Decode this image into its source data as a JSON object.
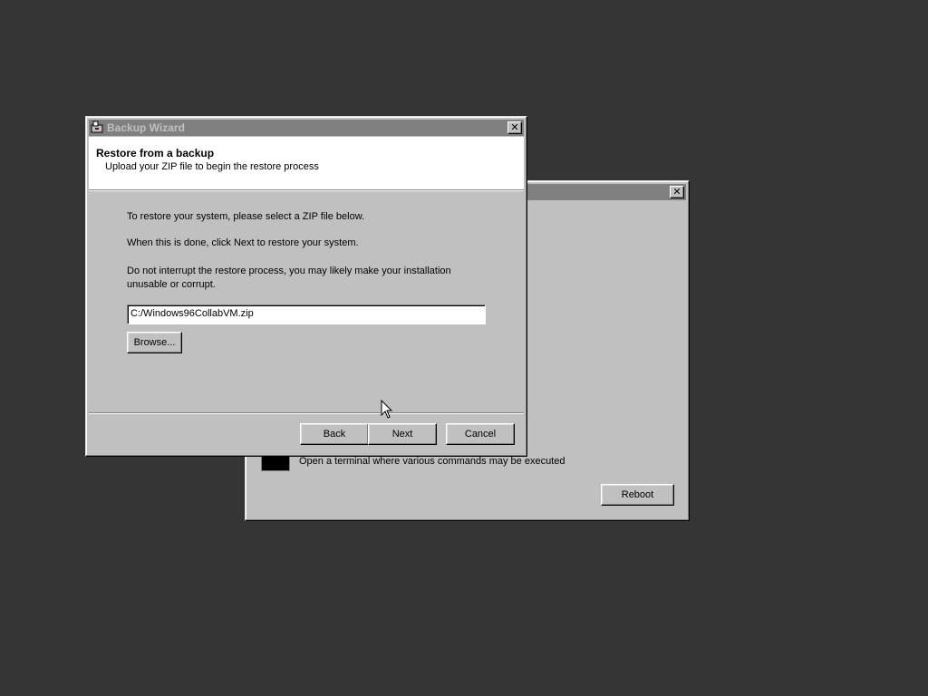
{
  "back_window": {
    "close_glyph": "✕",
    "terminal_description": "Open a terminal where various commands may be executed",
    "reboot_label": "Reboot"
  },
  "wizard": {
    "title": "Backup Wizard",
    "close_glyph": "✕",
    "header_title": "Restore from a backup",
    "header_subtitle": "Upload your ZIP file to begin the restore process",
    "instruction_1": "To restore your system, please select a ZIP file below.",
    "instruction_2": "When this is done, click Next to restore your system.",
    "warning": "Do not interrupt the restore process, you may likely make your installation unusable or corrupt.",
    "file_path": "C:/Windows96CollabVM.zip",
    "browse_label": "Browse...",
    "back_label": "Back",
    "next_label": "Next",
    "cancel_label": "Cancel"
  }
}
